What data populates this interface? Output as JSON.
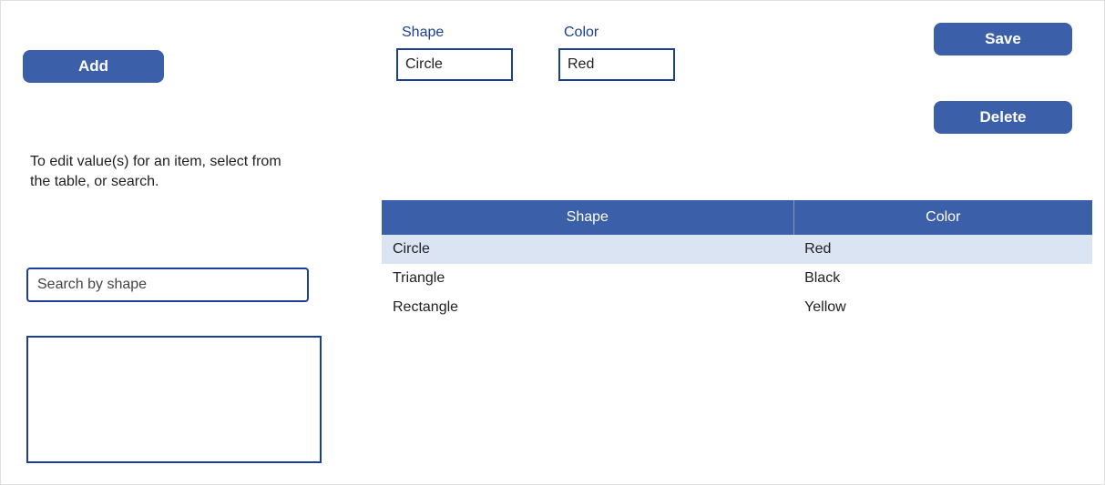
{
  "buttons": {
    "add": "Add",
    "save": "Save",
    "delete": "Delete"
  },
  "fields": {
    "shape": {
      "label": "Shape",
      "value": "Circle"
    },
    "color": {
      "label": "Color",
      "value": "Red"
    }
  },
  "instruction": "To edit value(s) for an item, select from the table, or search.",
  "search": {
    "placeholder": "Search by shape",
    "value": ""
  },
  "table": {
    "headers": {
      "shape": "Shape",
      "color": "Color"
    },
    "rows": [
      {
        "shape": "Circle",
        "color": "Red",
        "selected": true
      },
      {
        "shape": "Triangle",
        "color": "Black",
        "selected": false
      },
      {
        "shape": "Rectangle",
        "color": "Yellow",
        "selected": false
      }
    ]
  },
  "colors": {
    "primary": "#3b5fa8",
    "border": "#1b3f92",
    "rowSelected": "#dbe4f3"
  }
}
